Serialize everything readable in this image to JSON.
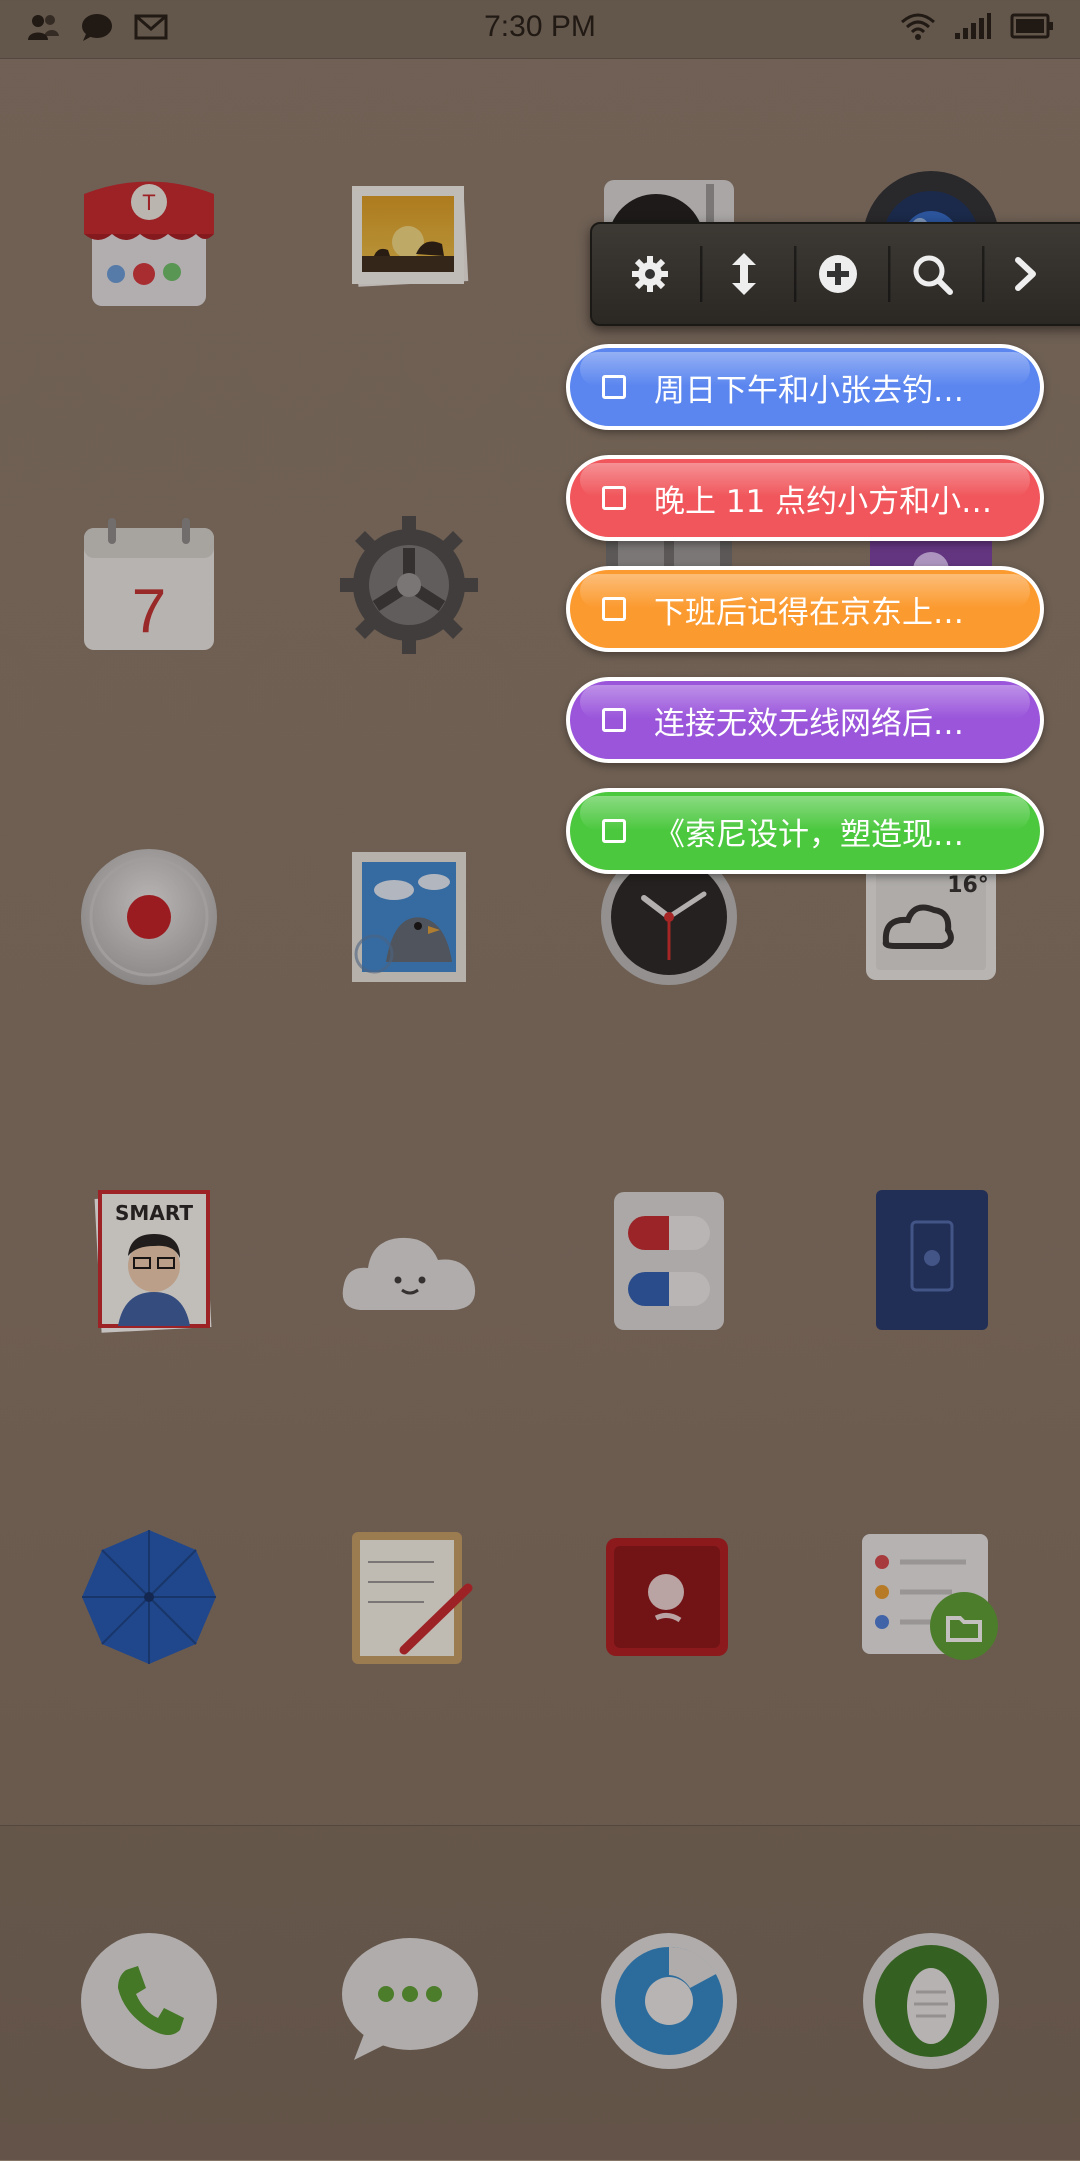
{
  "status_bar": {
    "time": "7:30 PM",
    "left_icons": [
      "contacts-icon",
      "chat-bubble-icon",
      "mail-icon"
    ],
    "right_icons": [
      "wifi-icon",
      "signal-icon",
      "battery-icon"
    ]
  },
  "toolbar": {
    "buttons": [
      "gear-icon",
      "vertical-resize-icon",
      "add-icon",
      "search-icon",
      "chevron-right-icon"
    ]
  },
  "todos": [
    {
      "text": "周日下午和小张去钓…",
      "color": "#5b86ef"
    },
    {
      "text": "晚上 11 点约小方和小…",
      "color": "#f0565b"
    },
    {
      "text": "下班后记得在京东上…",
      "color": "#fb9a2f"
    },
    {
      "text": "连接无效无线网络后…",
      "color": "#9a55db"
    },
    {
      "text": "《索尼设计，塑造现…",
      "color": "#4cc83f"
    }
  ],
  "calendar_day": "7",
  "weather_temp": "16°",
  "magazine_title": "SMART",
  "colors": {
    "wallpaper": "#8a7868"
  }
}
